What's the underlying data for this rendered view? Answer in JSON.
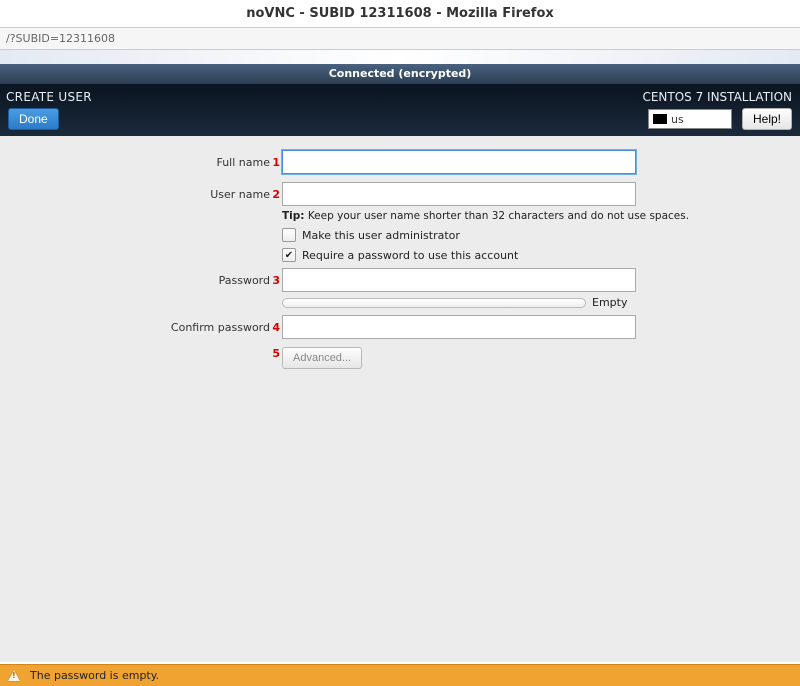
{
  "window": {
    "title": "noVNC - SUBID 12311608 - Mozilla Firefox"
  },
  "urlbar": {
    "text": "/?SUBID=12311608"
  },
  "connection": {
    "status": "Connected (encrypted)"
  },
  "header": {
    "page_heading": "CREATE USER",
    "done_label": "Done",
    "installer_title": "CENTOS 7 INSTALLATION",
    "keyboard_layout": "us",
    "help_label": "Help!"
  },
  "form": {
    "markers": {
      "fullname": "1",
      "username": "2",
      "password": "3",
      "confirm": "4",
      "advanced": "5"
    },
    "labels": {
      "fullname": "Full name",
      "username": "User name",
      "password": "Password",
      "confirm": "Confirm password"
    },
    "values": {
      "fullname": "",
      "username": "",
      "password": "",
      "confirm": ""
    },
    "tip_prefix": "Tip:",
    "tip_text": " Keep your user name shorter than 32 characters and do not use spaces.",
    "checkbox_admin": "Make this user administrator",
    "checkbox_require_pw": "Require a password to use this account",
    "strength_label": "Empty",
    "advanced_label": "Advanced..."
  },
  "warning": {
    "text": "The password is empty."
  }
}
